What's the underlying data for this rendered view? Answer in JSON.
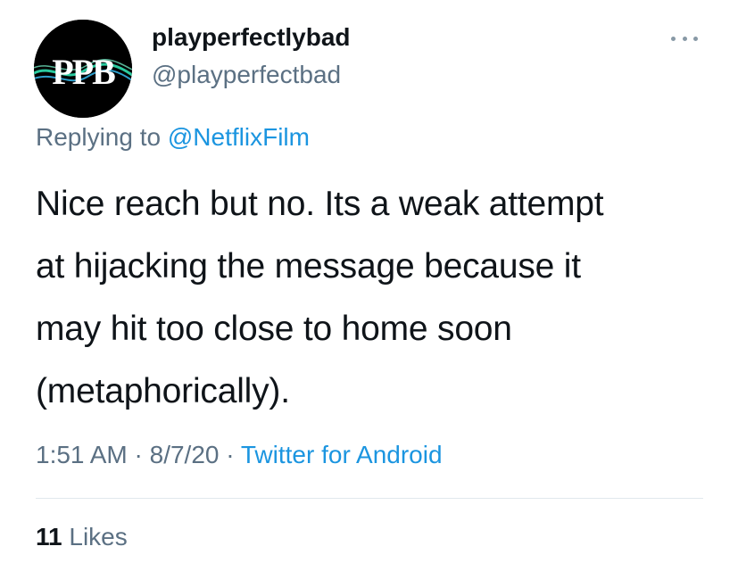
{
  "author": {
    "avatar_text": "PPB",
    "display_name": "playperfectlybad",
    "handle": "@playperfectbad"
  },
  "reply": {
    "prefix": "Replying to ",
    "mention": "@NetflixFilm"
  },
  "tweet": {
    "lines": [
      "Nice reach but no. Its a weak attempt",
      "at hijacking the message because it",
      "may hit too close to home soon",
      "(metaphorically)."
    ]
  },
  "meta": {
    "time": "1:51 AM",
    "separator": " · ",
    "date": "8/7/20",
    "source": "Twitter for Android"
  },
  "engagement": {
    "likes_count": "11",
    "likes_label": " Likes"
  },
  "icons": {
    "more": "more-options-icon"
  },
  "colors": {
    "link": "#1b95e0",
    "secondary": "#5b7083",
    "primary": "#0f1419",
    "divider": "#e1e8ed"
  }
}
